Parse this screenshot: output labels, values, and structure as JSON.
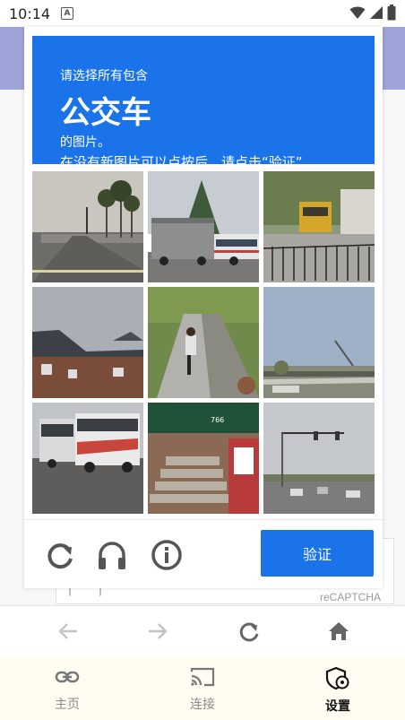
{
  "status_bar": {
    "time": "10:14",
    "notification_letter": "A"
  },
  "captcha": {
    "instruction_line1": "请选择所有包含",
    "target": "公交车",
    "instruction_line2": "的图片。",
    "instruction_line3": "在没有新图片可以点按后，请点击“验证”",
    "tiles": [
      "street-with-palm-trees",
      "truck-and-bus",
      "school-bus-parking-lot",
      "houses-rooftops",
      "cyclist-on-path",
      "highway-overpass",
      "tour-buses",
      "stairs-green-awning",
      "intersection-traffic-lights"
    ],
    "controls": [
      "reload-icon",
      "headphones-icon",
      "info-icon"
    ],
    "verify_label": "验证",
    "brand": "reCAPTCHA"
  },
  "browser_nav": {
    "icons": [
      "back-arrow-icon",
      "forward-arrow-icon",
      "refresh-icon",
      "home-icon"
    ]
  },
  "tabs": [
    {
      "label": "主页",
      "icon": "link-icon",
      "active": false
    },
    {
      "label": "连接",
      "icon": "cast-icon",
      "active": false
    },
    {
      "label": "设置",
      "icon": "shield-gear-icon",
      "active": true
    }
  ],
  "colors": {
    "accent": "#1a73e8",
    "header_bg": "#9ea3d8",
    "tabbar_bg": "#fffdf2"
  }
}
